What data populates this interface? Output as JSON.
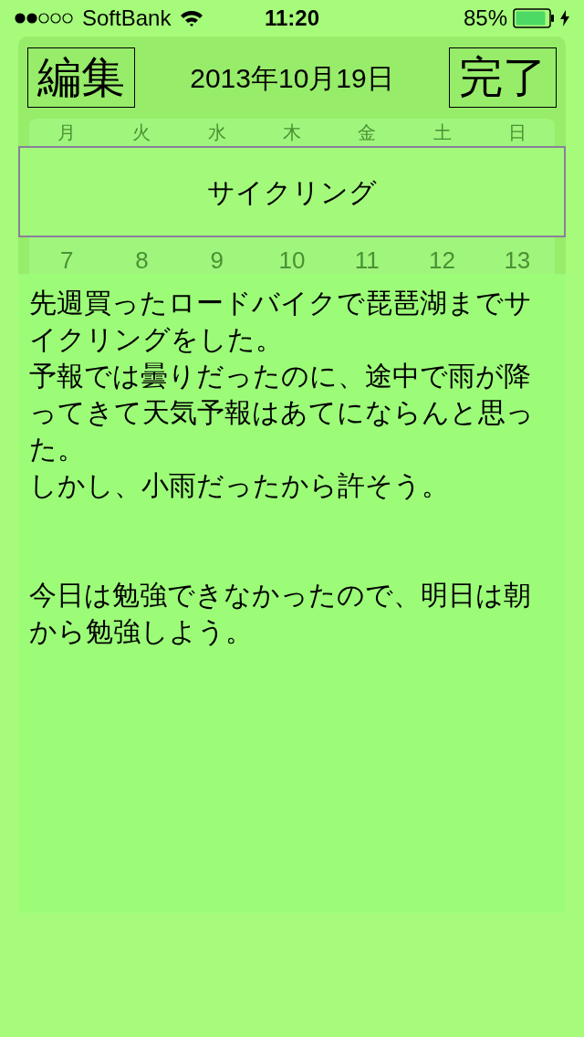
{
  "status_bar": {
    "carrier": "SoftBank",
    "time": "11:20",
    "battery": "85%"
  },
  "header": {
    "edit_button": "編集",
    "date": "2013年10月19日",
    "done_button": "完了"
  },
  "calendar": {
    "weekdays": [
      "月",
      "火",
      "水",
      "木",
      "金",
      "土",
      "日"
    ],
    "rows": [
      [
        "7",
        "8",
        "9",
        "10",
        "11",
        "12",
        "13"
      ]
    ]
  },
  "entry": {
    "title": "サイクリング",
    "paragraphs": [
      [
        "先週買ったロードバイクで琵琶湖までサイクリングをした。",
        "予報では曇りだったのに、途中で雨が降ってきて天気予報はあてにならんと思った。",
        "しかし、小雨だったから許そう。"
      ],
      [
        "今日は勉強できなかったので、明日は朝から勉強しよう。"
      ]
    ]
  }
}
